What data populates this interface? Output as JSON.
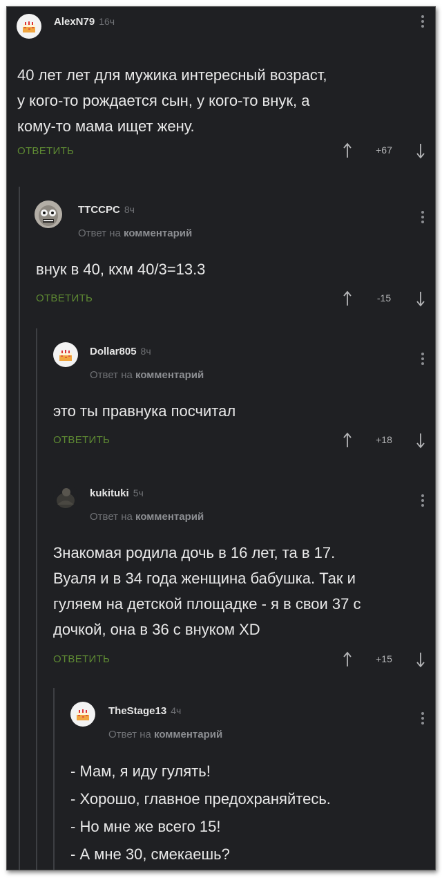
{
  "comments": [
    {
      "user": "AlexN79",
      "time": "16ч",
      "reply_to": "",
      "lines": [
        "40 лет лет для мужика интересный возраст,",
        "у кого-то рождается сын, у кого-то внук, а",
        "кому-то мама ищет жену."
      ],
      "reply_label": "ОТВЕТИТЬ",
      "score": "+67"
    },
    {
      "user": "TTCCPC",
      "time": "8ч",
      "reply_to_prefix": "Ответ на",
      "reply_to_link": "комментарий",
      "lines": [
        "внук в 40, кхм 40/3=13.3"
      ],
      "reply_label": "ОТВЕТИТЬ",
      "score": "-15"
    },
    {
      "user": "Dollar805",
      "time": "8ч",
      "reply_to_prefix": "Ответ на",
      "reply_to_link": "комментарий",
      "lines": [
        "это ты правнука посчитал"
      ],
      "reply_label": "ОТВЕТИТЬ",
      "score": "+18"
    },
    {
      "user": "kukituki",
      "time": "5ч",
      "reply_to_prefix": "Ответ на",
      "reply_to_link": "комментарий",
      "lines": [
        "Знакомая родила дочь в 16 лет, та в 17.",
        "Вуаля и в 34 года женщина бабушка. Так и",
        "гуляем на детской площадке - я в свои 37 с",
        "дочкой, она в 36 с внуком XD"
      ],
      "reply_label": "ОТВЕТИТЬ",
      "score": "+15"
    },
    {
      "user": "TheStage13",
      "time": "4ч",
      "reply_to_prefix": "Ответ на",
      "reply_to_link": "комментарий",
      "lines": [
        "- Мам, я иду гулять!",
        "- Хорошо, главное предохраняйтесь.",
        "- Но мне же всего 15!",
        "- А мне 30, смекаешь?"
      ]
    }
  ],
  "colors": {
    "background": "#1f2023",
    "reply": "#5e8a33",
    "muted": "#6f7175",
    "text": "#e9e9e9"
  },
  "icons": [
    "cake-avatar-icon",
    "more-vertical-icon",
    "arrow-up-icon",
    "arrow-down-icon"
  ]
}
